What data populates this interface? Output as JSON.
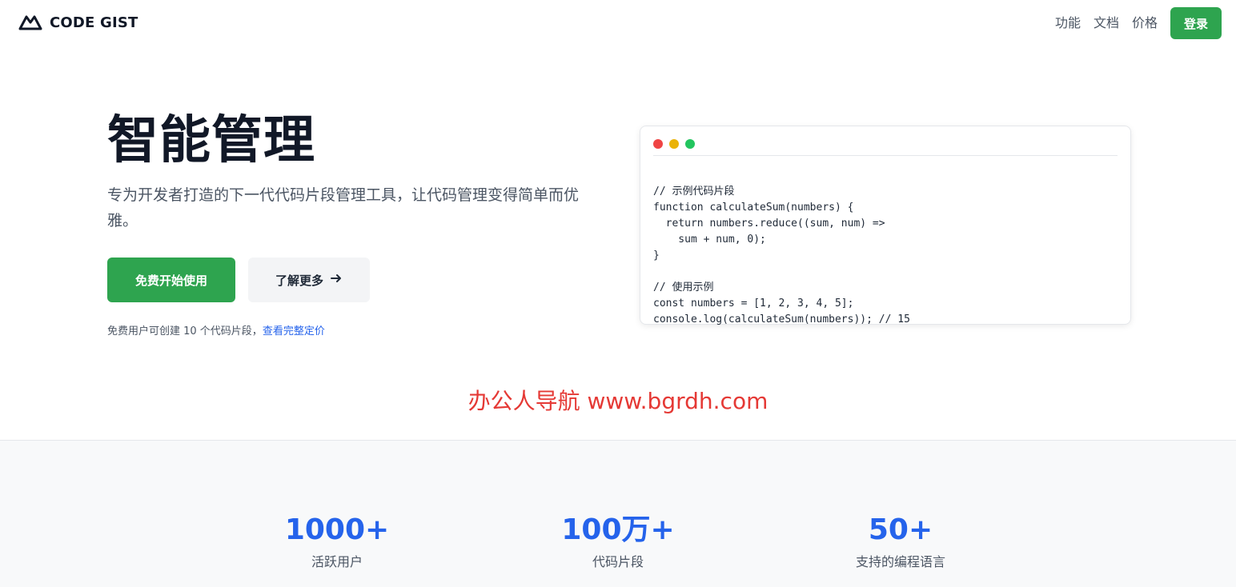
{
  "header": {
    "brand": "CODE GIST",
    "nav": [
      "功能",
      "文档",
      "价格"
    ],
    "login_label": "登录"
  },
  "hero": {
    "title": "智能管理",
    "description": "专为开发者打造的下一代代码片段管理工具，让代码管理变得简单而优雅。",
    "primary_button": "免费开始使用",
    "secondary_button": "了解更多",
    "note_text": "免费用户可创建 10 个代码片段，",
    "note_link": "查看完整定价"
  },
  "code_card": {
    "lines": [
      "// 示例代码片段",
      "function calculateSum(numbers) {",
      "  return numbers.reduce((sum, num) =>",
      "    sum + num, 0);",
      "}",
      "",
      "// 使用示例",
      "const numbers = [1, 2, 3, 4, 5];",
      "console.log(calculateSum(numbers)); // 15"
    ]
  },
  "watermark": "办公人导航 www.bgrdh.com",
  "stats": [
    {
      "value": "1000+",
      "label": "活跃用户"
    },
    {
      "value": "100万+",
      "label": "代码片段"
    },
    {
      "value": "50+",
      "label": "支持的编程语言"
    }
  ],
  "colors": {
    "primary_green": "#2ea44f",
    "accent_blue": "#2563eb",
    "watermark_red": "#e53935"
  },
  "icons": {
    "logo": "mountain-logo-icon",
    "arrow": "arrow-right-icon"
  }
}
